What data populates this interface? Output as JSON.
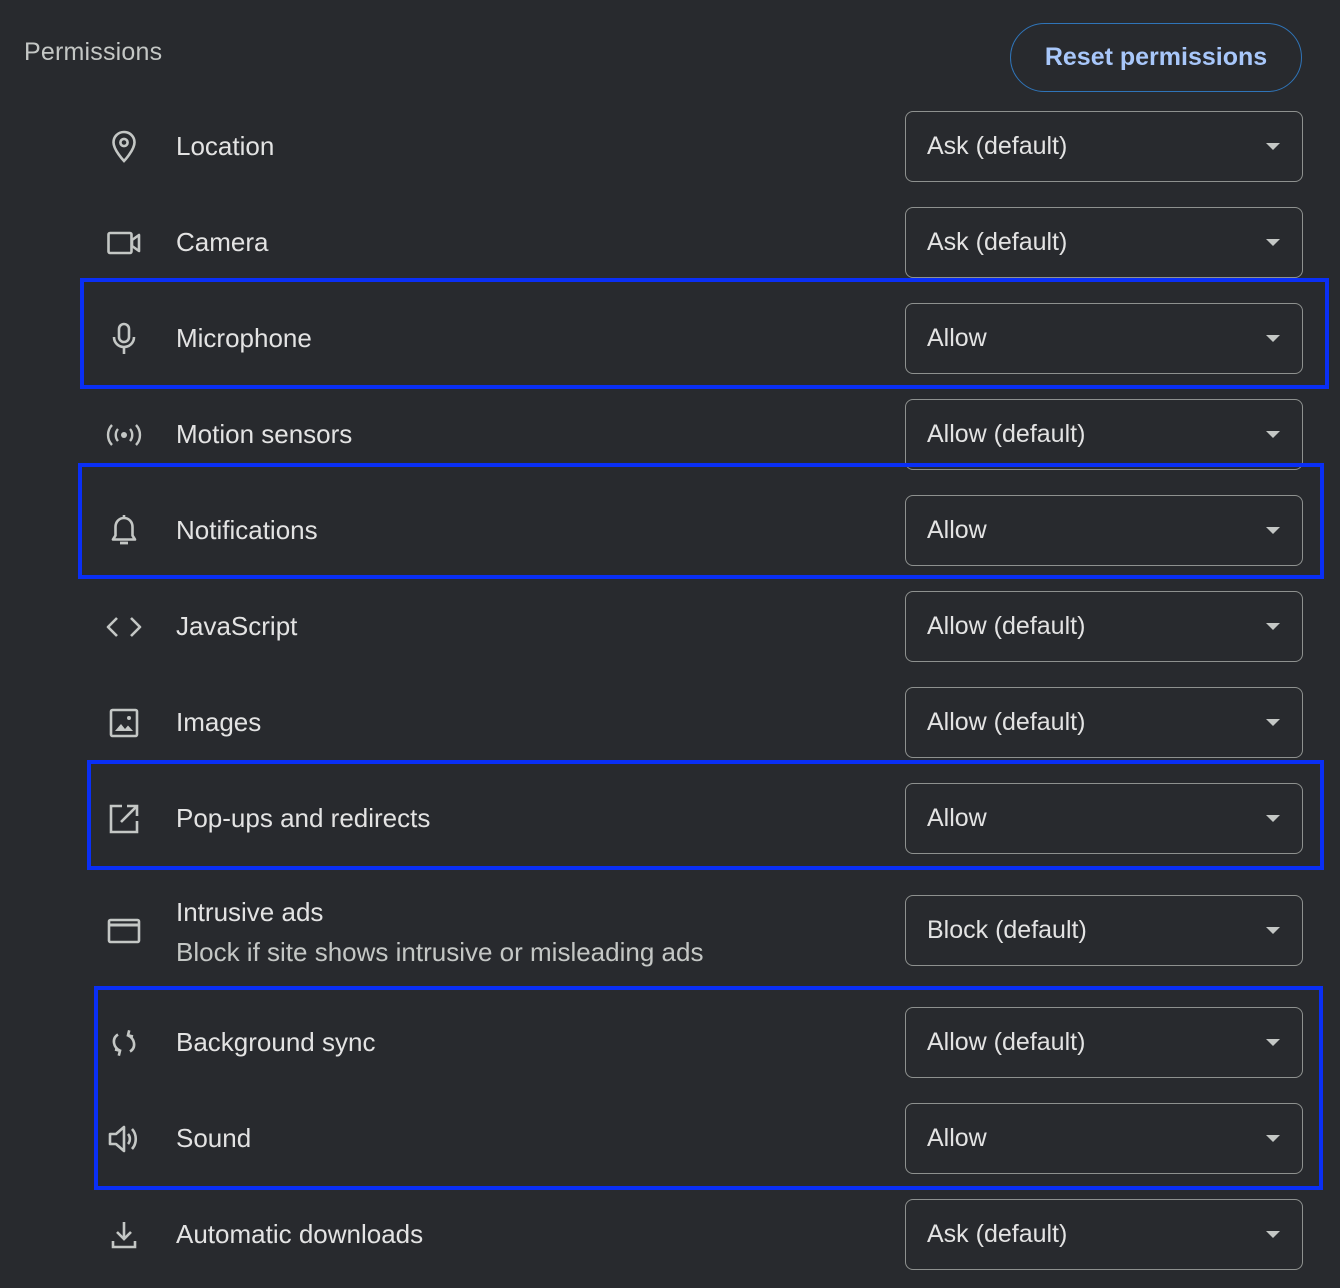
{
  "section": {
    "title": "Permissions",
    "reset_label": "Reset permissions"
  },
  "permissions": [
    {
      "label": "Location",
      "value": "Ask (default)",
      "icon": "location-pin-icon"
    },
    {
      "label": "Camera",
      "value": "Ask (default)",
      "icon": "camera-icon"
    },
    {
      "label": "Microphone",
      "value": "Allow",
      "icon": "microphone-icon"
    },
    {
      "label": "Motion sensors",
      "value": "Allow (default)",
      "icon": "motion-sensors-icon"
    },
    {
      "label": "Notifications",
      "value": "Allow",
      "icon": "bell-icon"
    },
    {
      "label": "JavaScript",
      "value": "Allow (default)",
      "icon": "code-icon"
    },
    {
      "label": "Images",
      "value": "Allow (default)",
      "icon": "image-icon"
    },
    {
      "label": "Pop-ups and redirects",
      "value": "Allow",
      "icon": "open-in-new-icon"
    },
    {
      "label": "Intrusive ads",
      "sublabel": "Block if site shows intrusive or misleading ads",
      "value": "Block (default)",
      "icon": "ads-window-icon"
    },
    {
      "label": "Background sync",
      "value": "Allow (default)",
      "icon": "sync-icon"
    },
    {
      "label": "Sound",
      "value": "Allow",
      "icon": "speaker-icon"
    },
    {
      "label": "Automatic downloads",
      "value": "Ask (default)",
      "icon": "download-icon"
    }
  ],
  "colors": {
    "background": "#282a2e",
    "accent": "#a8c7fa",
    "highlight_box": "#0a2ff5"
  }
}
